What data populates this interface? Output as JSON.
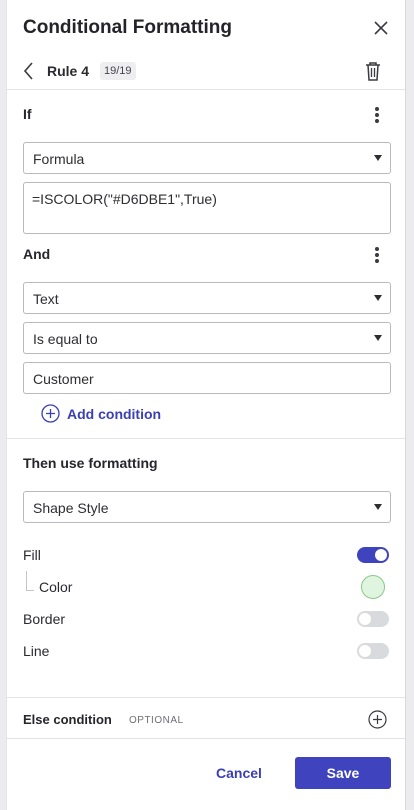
{
  "header": {
    "title": "Conditional Formatting",
    "close_icon": "close-icon"
  },
  "rule": {
    "name": "Rule 4",
    "count": "19/19",
    "back_icon": "chevron-left-icon",
    "delete_icon": "trash-icon"
  },
  "if_section": {
    "label": "If",
    "type_select": "Formula",
    "formula": "=ISCOLOR(\"#D6DBE1\",True)"
  },
  "and_section": {
    "label": "And",
    "field_select": "Text",
    "operator_select": "Is equal to",
    "value": "Customer",
    "add_condition": "Add condition"
  },
  "formatting": {
    "label": "Then use formatting",
    "style_select": "Shape Style",
    "fill": {
      "label": "Fill",
      "enabled": true
    },
    "color": {
      "label": "Color",
      "value": "#dff5df"
    },
    "border": {
      "label": "Border",
      "enabled": false
    },
    "line": {
      "label": "Line",
      "enabled": false
    }
  },
  "else_section": {
    "label": "Else condition",
    "optional": "OPTIONAL"
  },
  "footer": {
    "cancel": "Cancel",
    "save": "Save"
  },
  "colors": {
    "accent": "#3f43bd",
    "link": "#3a3fb6"
  }
}
